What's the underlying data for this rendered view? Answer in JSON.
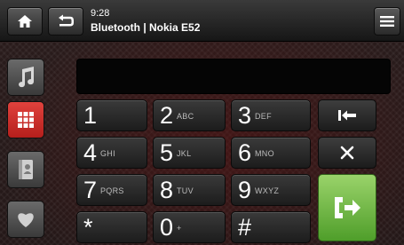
{
  "status": {
    "time": "9:28",
    "connection": "Bluetooth | Nokia E52"
  },
  "topbar": {
    "home_icon": "home-icon",
    "back_icon": "back-icon",
    "menu_icon": "menu-icon"
  },
  "sidebar": [
    {
      "name": "music",
      "icon": "music-note-icon",
      "active": false
    },
    {
      "name": "dialpad",
      "icon": "dialpad-grid-icon",
      "active": true
    },
    {
      "name": "contacts",
      "icon": "contacts-book-icon",
      "active": false
    },
    {
      "name": "favorites",
      "icon": "heart-icon",
      "active": false
    }
  ],
  "dialer": {
    "number_display": ""
  },
  "keys": [
    {
      "digit": "1",
      "letters": ""
    },
    {
      "digit": "2",
      "letters": "ABC"
    },
    {
      "digit": "3",
      "letters": "DEF"
    },
    {
      "digit": "4",
      "letters": "GHI"
    },
    {
      "digit": "5",
      "letters": "JKL"
    },
    {
      "digit": "6",
      "letters": "MNO"
    },
    {
      "digit": "7",
      "letters": "PQRS"
    },
    {
      "digit": "8",
      "letters": "TUV"
    },
    {
      "digit": "9",
      "letters": "WXYZ"
    },
    {
      "digit": "*",
      "letters": ""
    },
    {
      "digit": "0",
      "letters": "+"
    },
    {
      "digit": "#",
      "letters": ""
    }
  ],
  "functions": {
    "backspace_icon": "backspace-icon",
    "clear_icon": "clear-x-icon",
    "call_icon": "call-icon"
  },
  "colors": {
    "accent_red": "#c8302c",
    "call_green": "#6cb83c"
  }
}
